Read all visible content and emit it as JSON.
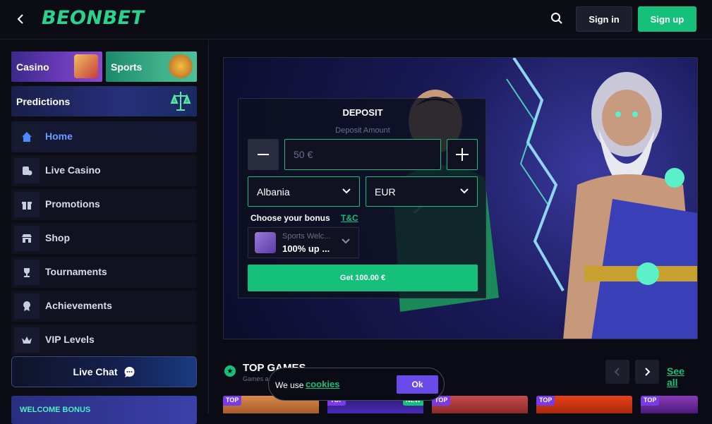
{
  "header": {
    "logo": "BEONBET",
    "signin_label": "Sign in",
    "signup_label": "Sign up"
  },
  "sidebar": {
    "categories": [
      {
        "label": "Casino"
      },
      {
        "label": "Sports"
      },
      {
        "label": "Predictions"
      }
    ],
    "items": [
      {
        "label": "Home",
        "icon": "home-icon",
        "active": true
      },
      {
        "label": "Live Casino",
        "icon": "live-casino-icon"
      },
      {
        "label": "Promotions",
        "icon": "gift-icon"
      },
      {
        "label": "Shop",
        "icon": "shop-icon"
      },
      {
        "label": "Tournaments",
        "icon": "trophy-icon"
      },
      {
        "label": "Achievements",
        "icon": "medal-icon"
      },
      {
        "label": "VIP Levels",
        "icon": "crown-icon"
      }
    ],
    "live_chat_label": "Live Chat",
    "welcome_label": "WELCOME BONUS"
  },
  "deposit": {
    "title": "DEPOSIT",
    "amount_label": "Deposit Amount",
    "amount_placeholder": "50 €",
    "country": "Albania",
    "currency": "EUR",
    "choose_bonus_label": "Choose your bonus",
    "tc_label": "T&C",
    "bonus_small": "Sports Welc...",
    "bonus_main": "100% up ...",
    "submit_label": "Get 100.00 €"
  },
  "games": {
    "title": "TOP GAMES",
    "subtitle": "Games a",
    "see_all_label": "See all",
    "tiles": [
      {
        "tag": "TOP",
        "color": "#c85a2a"
      },
      {
        "tag": "TOP",
        "tag2": "NEW",
        "color": "#2a1a6a"
      },
      {
        "tag": "TOP",
        "color": "#a83a3a"
      },
      {
        "tag": "TOP",
        "color": "#c8301a"
      },
      {
        "tag": "TOP",
        "color": "#6a2a8a"
      }
    ]
  },
  "cookie": {
    "text": "We use",
    "link": "cookies",
    "ok_label": "Ok"
  },
  "colors": {
    "accent": "#14c07a",
    "active_blue": "#6a9cff",
    "purple": "#6a4ae8"
  }
}
